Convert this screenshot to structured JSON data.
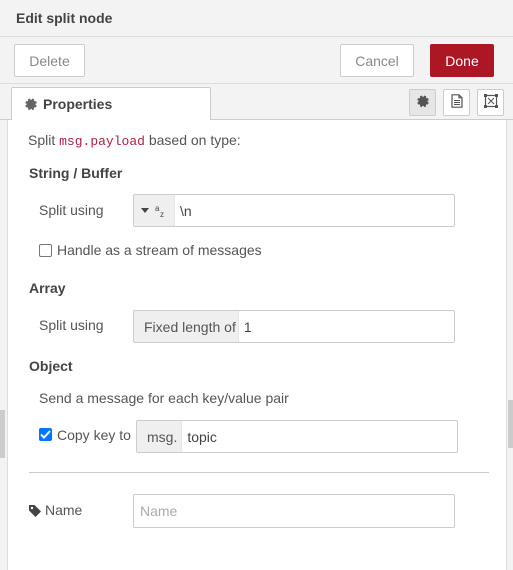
{
  "header": {
    "title": "Edit split node"
  },
  "toolbar": {
    "delete_label": "Delete",
    "cancel_label": "Cancel",
    "done_label": "Done"
  },
  "tabs": {
    "properties_label": "Properties"
  },
  "intro": {
    "prefix": "Split ",
    "code": "msg.payload",
    "suffix": " based on type:"
  },
  "string_buffer": {
    "heading": "String / Buffer",
    "split_using_label": "Split using",
    "split_type_icon": "string-type-icon",
    "split_value": "\\n",
    "stream_label": "Handle as a stream of messages",
    "stream_checked": false
  },
  "array": {
    "heading": "Array",
    "split_using_label": "Split using",
    "split_type_label": "Fixed length of",
    "split_value": "1"
  },
  "object": {
    "heading": "Object",
    "description": "Send a message for each key/value pair",
    "copy_key_label": "Copy key to",
    "copy_key_checked": true,
    "copy_key_type": "msg.",
    "copy_key_value": "topic"
  },
  "name": {
    "label": "Name",
    "placeholder": "Name",
    "value": ""
  },
  "colors": {
    "done_button": "#ad1625",
    "code_text": "#aa2244",
    "checkbox_checked": "#0075ff"
  }
}
